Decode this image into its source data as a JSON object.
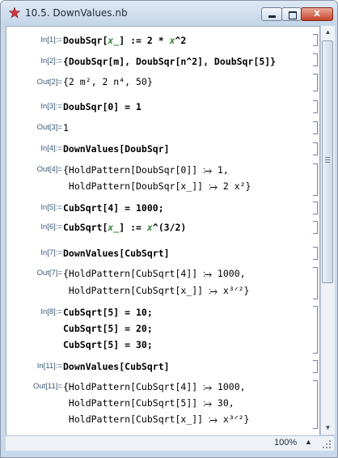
{
  "window": {
    "title": "10.5. DownValues.nb",
    "close_glyph": "x",
    "icon": "mathematica-star-icon"
  },
  "cells": [
    {
      "label": "In[1]:=",
      "lines": [
        "DoubSqr[x_] := 2 * x^2"
      ]
    },
    {
      "label": "In[2]:=",
      "lines": [
        "{DoubSqr[m], DoubSqr[n^2], DoubSqr[5]}"
      ]
    },
    {
      "label": "Out[2]=",
      "lines": [
        "{2 m², 2 n⁴, 50}"
      ]
    },
    {
      "label": "In[3]:=",
      "lines": [
        "DoubSqr[0] = 1"
      ]
    },
    {
      "label": "Out[3]=",
      "lines": [
        "1"
      ]
    },
    {
      "label": "In[4]:=",
      "lines": [
        "DownValues[DoubSqr]"
      ]
    },
    {
      "label": "Out[4]=",
      "lines": [
        "{HoldPattern[DoubSqr[0]] ⧴ 1,",
        " HoldPattern[DoubSqr[x_]] ⧴ 2 x²}"
      ]
    },
    {
      "label": "In[5]:=",
      "lines": [
        "CubSqrt[4] = 1000;"
      ]
    },
    {
      "label": "In[6]:=",
      "lines": [
        "CubSqrt[x_] := x^(3/2)"
      ]
    },
    {
      "label": "In[7]:=",
      "lines": [
        "DownValues[CubSqrt]"
      ]
    },
    {
      "label": "Out[7]=",
      "lines": [
        "{HoldPattern[CubSqrt[4]] ⧴ 1000,",
        " HoldPattern[CubSqrt[x_]] ⧴ x³ᐟ²}"
      ]
    },
    {
      "label": "In[8]:=",
      "lines": [
        "CubSqrt[5] = 10;",
        "CubSqrt[5] = 20;",
        "CubSqrt[5] = 30;"
      ]
    },
    {
      "label": "In[11]:=",
      "lines": [
        "DownValues[CubSqrt]"
      ]
    },
    {
      "label": "Out[11]=",
      "lines": [
        "{HoldPattern[CubSqrt[4]] ⧴ 1000,",
        " HoldPattern[CubSqrt[5]] ⧴ 30,",
        " HoldPattern[CubSqrt[x_]] ⧴ x³ᐟ²}"
      ]
    }
  ],
  "status": {
    "zoom": "100%",
    "zoom_arrow": "▲"
  },
  "scrollbar": {
    "up": "▲",
    "down": "▼"
  }
}
